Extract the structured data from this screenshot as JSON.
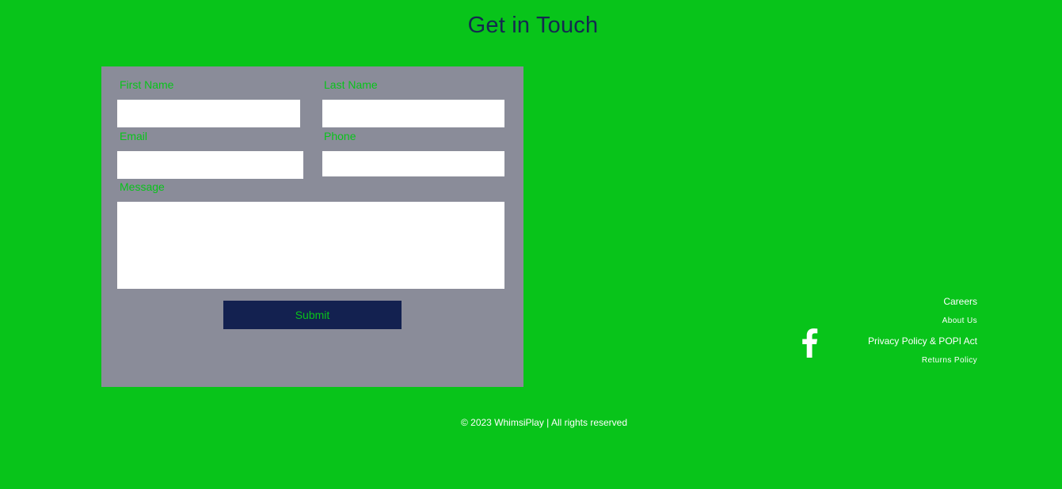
{
  "page": {
    "title": "Get in Touch"
  },
  "form": {
    "first_name": {
      "label": "First Name",
      "value": "",
      "placeholder": ""
    },
    "last_name": {
      "label": "Last Name",
      "value": "",
      "placeholder": ""
    },
    "email": {
      "label": "Email",
      "value": "",
      "placeholder": ""
    },
    "phone": {
      "label": "Phone",
      "value": "",
      "placeholder": ""
    },
    "message": {
      "label": "Message",
      "value": "",
      "placeholder": ""
    },
    "submit_label": "Submit"
  },
  "social": {
    "facebook_icon": "facebook-icon"
  },
  "footer": {
    "links": [
      "Careers",
      "About Us",
      "Privacy Policy & POPI Act",
      "Returns Policy"
    ],
    "copyright": "© 2023 WhimsiPlay | All rights reserved"
  },
  "colors": {
    "background": "#08c41a",
    "form_panel": "#8a8c99",
    "title": "#142a4f",
    "button": "#132150",
    "label": "#08c41a",
    "footer_text": "#ffffff"
  }
}
